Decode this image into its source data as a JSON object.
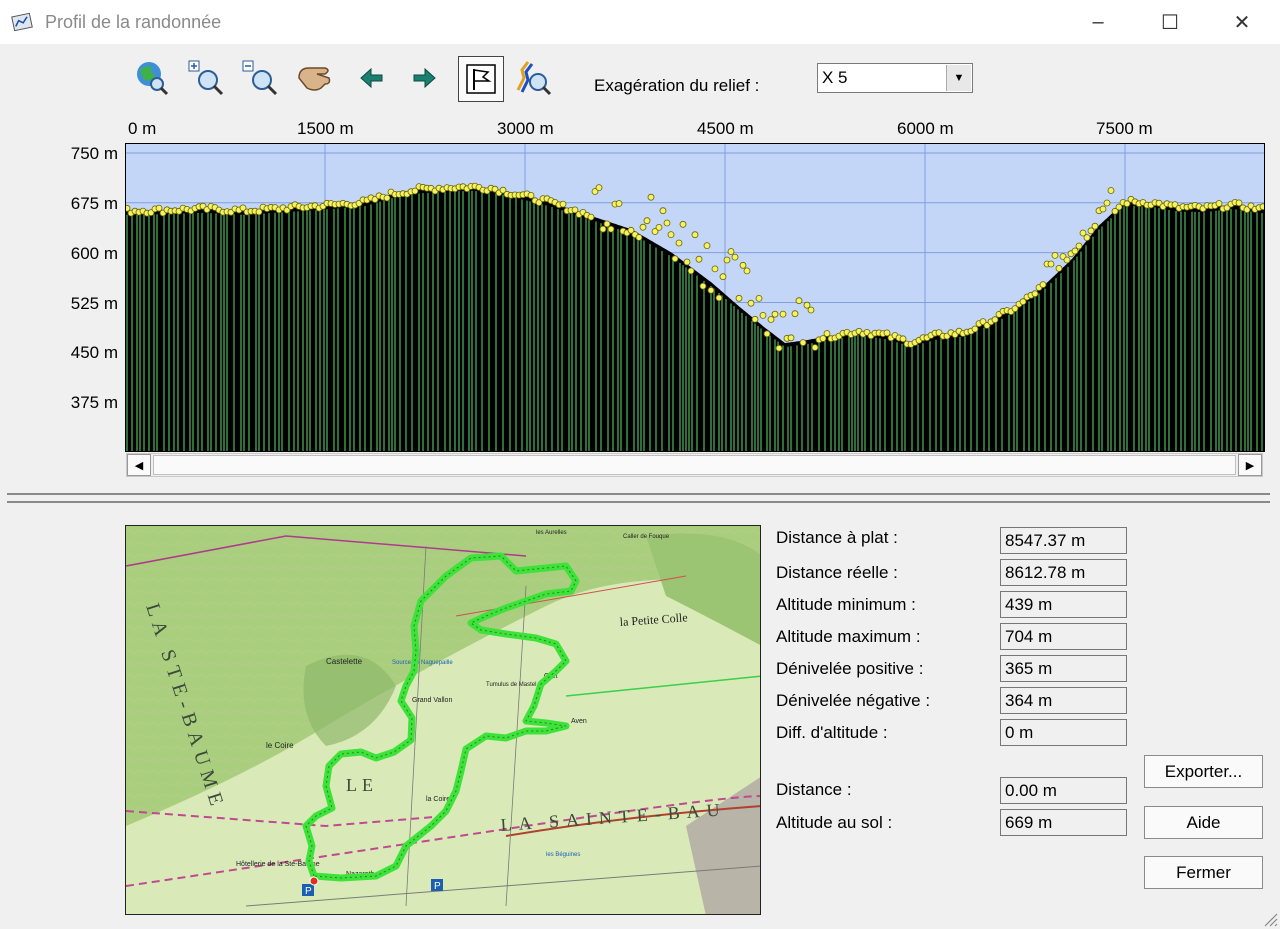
{
  "window": {
    "title": "Profil de la randonnée"
  },
  "toolbar": {
    "icons": [
      "globe-zoom-icon",
      "zoom-in-icon",
      "zoom-out-icon",
      "pan-hand-icon",
      "arrow-left-icon",
      "arrow-right-icon",
      "flag-icon",
      "route-zoom-icon"
    ],
    "relief_label": "Exagération du relief :",
    "relief_value": "X 5"
  },
  "chart_data": {
    "type": "area",
    "x_ticks": [
      "0 m",
      "1500 m",
      "3000 m",
      "4500 m",
      "6000 m",
      "7500 m"
    ],
    "y_ticks": [
      "750 m",
      "675 m",
      "600 m",
      "525 m",
      "450 m",
      "375 m"
    ],
    "xlim": [
      0,
      8547
    ],
    "ylim": [
      300,
      765
    ],
    "grid": true,
    "x": [
      0,
      300,
      600,
      900,
      1200,
      1500,
      1800,
      2000,
      2200,
      2400,
      2600,
      2750,
      3000,
      3200,
      3500,
      3800,
      4100,
      4400,
      4600,
      4800,
      4950,
      5100,
      5300,
      5500,
      5700,
      5900,
      6100,
      6300,
      6500,
      6700,
      6900,
      7100,
      7300,
      7500,
      7700,
      7900,
      8100,
      8300,
      8547
    ],
    "y": [
      663,
      664,
      666,
      663,
      667,
      671,
      676,
      688,
      695,
      698,
      699,
      697,
      685,
      675,
      655,
      635,
      600,
      555,
      520,
      487,
      464,
      468,
      475,
      482,
      476,
      465,
      476,
      480,
      498,
      520,
      552,
      590,
      640,
      677,
      675,
      668,
      667,
      672,
      665
    ],
    "fill_color": "#000000",
    "sky_color": "#c3d6f7",
    "point_color": "#f5f266"
  },
  "stats": [
    {
      "label": "Distance à plat :",
      "value": "8547.37 m"
    },
    {
      "label": "Distance réelle :",
      "value": "8612.78 m"
    },
    {
      "label": "Altitude minimum :",
      "value": "439 m"
    },
    {
      "label": "Altitude maximum :",
      "value": "704 m"
    },
    {
      "label": "Dénivelée positive :",
      "value": "365 m"
    },
    {
      "label": "Dénivelée négative :",
      "value": "364 m"
    },
    {
      "label": "Diff. d'altitude :",
      "value": "0 m"
    },
    {
      "label": "Distance :",
      "value": "0.00 m"
    },
    {
      "label": "Altitude au sol :",
      "value": "669 m"
    }
  ],
  "buttons": {
    "export": "Exporter...",
    "help": "Aide",
    "close": "Fermer"
  },
  "map": {
    "labels": [
      "LA STE-BAUME",
      "LA SAINTE-BAU",
      "la Petite Colle",
      "Castelette",
      "Grand Vallon",
      "le Coire",
      "la Coire",
      "LE",
      "Nazareth",
      "Hôtellerie de la Ste-Baume",
      "Oret",
      "Aven",
      "Tumulus de Mastel",
      "Source de Naguepaille",
      "Caller de Fouque",
      "les Aurelles",
      "les Béguines"
    ],
    "route_color": "#3ee23a"
  }
}
